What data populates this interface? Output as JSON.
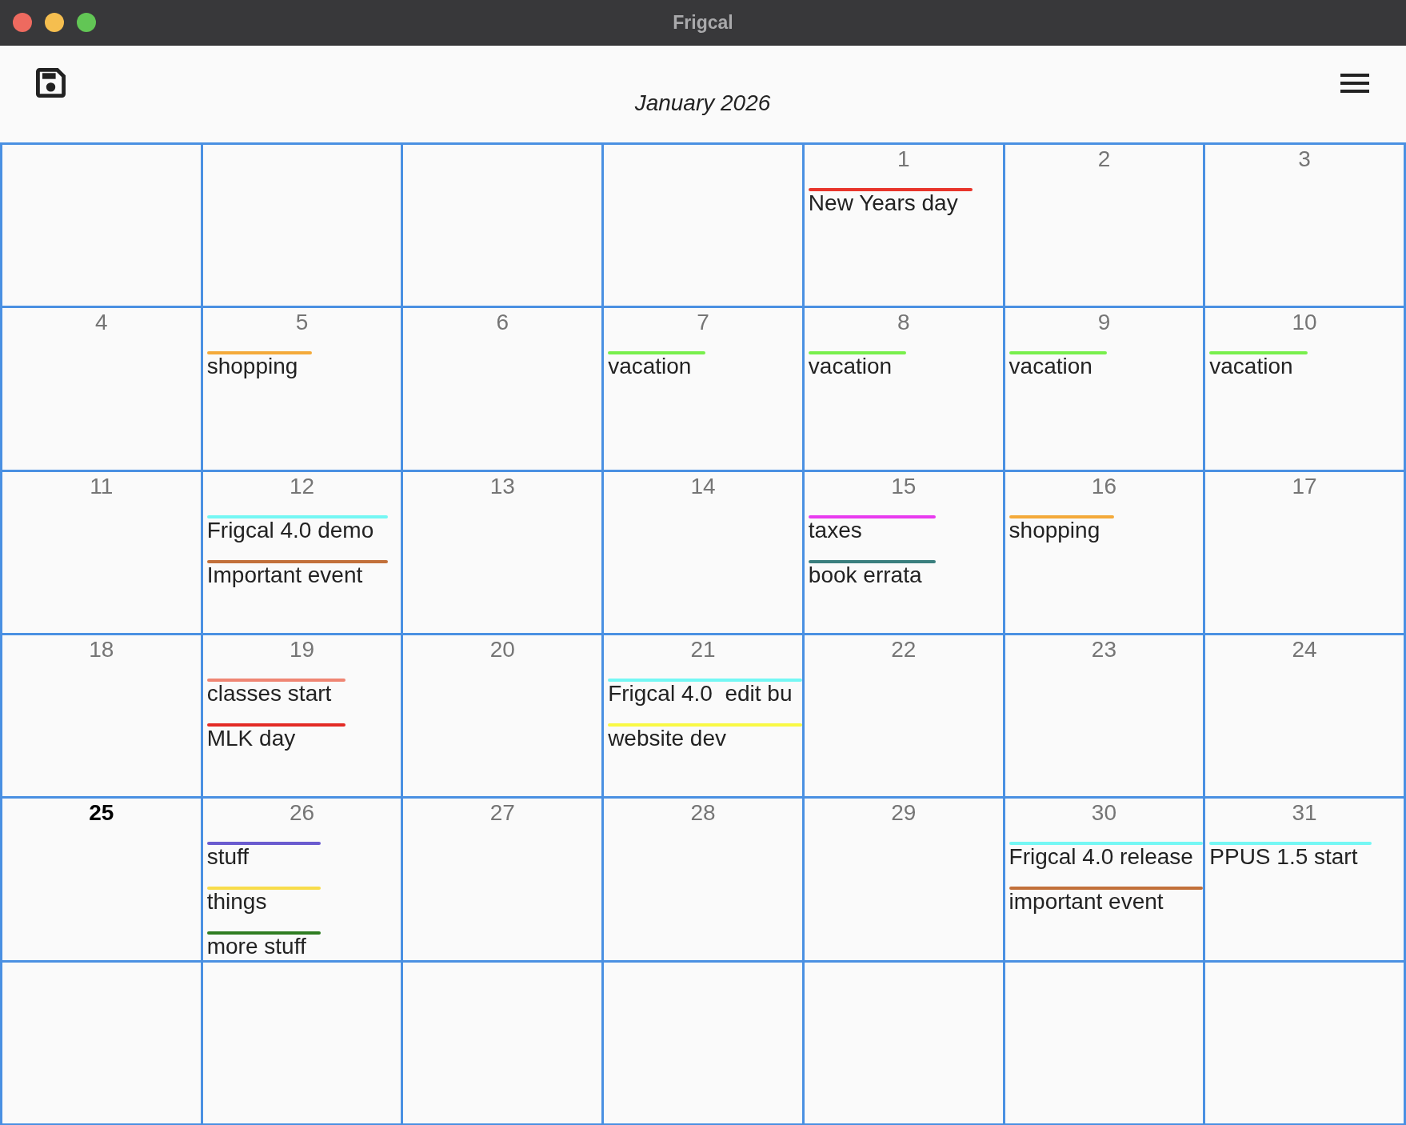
{
  "window": {
    "title": "Frigcal"
  },
  "toolbar": {
    "month_title": "January 2026"
  },
  "calendar": {
    "weeks": [
      {
        "days": [
          {
            "kind": "blank"
          },
          {
            "kind": "blank"
          },
          {
            "kind": "blank"
          },
          {
            "kind": "blank"
          },
          {
            "kind": "day",
            "date": "1",
            "today": false,
            "events": [
              {
                "title": "New Years day",
                "color": "#e8352b"
              }
            ]
          },
          {
            "kind": "day",
            "date": "2",
            "today": false
          },
          {
            "kind": "day",
            "date": "3",
            "today": false
          }
        ]
      },
      {
        "days": [
          {
            "kind": "day",
            "date": "4",
            "today": false
          },
          {
            "kind": "day",
            "date": "5",
            "today": false,
            "events": [
              {
                "title": "shopping",
                "color": "#f4aa3a"
              }
            ]
          },
          {
            "kind": "day",
            "date": "6",
            "today": false
          },
          {
            "kind": "day",
            "date": "7",
            "today": false,
            "events": [
              {
                "title": "vacation",
                "color": "#78ef4c"
              }
            ]
          },
          {
            "kind": "day",
            "date": "8",
            "today": false,
            "events": [
              {
                "title": "vacation",
                "color": "#78ef4c"
              }
            ]
          },
          {
            "kind": "day",
            "date": "9",
            "today": false,
            "events": [
              {
                "title": "vacation",
                "color": "#78ef4c"
              }
            ]
          },
          {
            "kind": "day",
            "date": "10",
            "today": false,
            "events": [
              {
                "title": "vacation",
                "color": "#78ef4c"
              }
            ]
          }
        ]
      },
      {
        "days": [
          {
            "kind": "day",
            "date": "11",
            "today": false
          },
          {
            "kind": "day",
            "date": "12",
            "today": false,
            "events": [
              {
                "title": "Frigcal 4.0 demo",
                "color": "#74f7f4"
              },
              {
                "title": "Important event",
                "color": "#c2703a"
              }
            ]
          },
          {
            "kind": "day",
            "date": "13",
            "today": false
          },
          {
            "kind": "day",
            "date": "14",
            "today": false
          },
          {
            "kind": "day",
            "date": "15",
            "today": false,
            "events": [
              {
                "title": "taxes",
                "color": "#e83bef"
              },
              {
                "title": "book errata",
                "color": "#3a7f7e"
              }
            ]
          },
          {
            "kind": "day",
            "date": "16",
            "today": false,
            "events": [
              {
                "title": "shopping",
                "color": "#f4aa3a"
              }
            ]
          },
          {
            "kind": "day",
            "date": "17",
            "today": false
          }
        ]
      },
      {
        "days": [
          {
            "kind": "day",
            "date": "18",
            "today": false
          },
          {
            "kind": "day",
            "date": "19",
            "today": false,
            "events": [
              {
                "title": "classes start",
                "color": "#ef8573"
              },
              {
                "title": "MLK day",
                "color": "#e32b25"
              }
            ]
          },
          {
            "kind": "day",
            "date": "20",
            "today": false
          },
          {
            "kind": "day",
            "date": "21",
            "today": false,
            "events": [
              {
                "title": "Frigcal 4.0  edit bu",
                "color": "#74f7f4"
              },
              {
                "title": "website dev",
                "color": "#f9f944"
              }
            ]
          },
          {
            "kind": "day",
            "date": "22",
            "today": false
          },
          {
            "kind": "day",
            "date": "23",
            "today": false
          },
          {
            "kind": "day",
            "date": "24",
            "today": false
          }
        ]
      },
      {
        "days": [
          {
            "kind": "day",
            "date": "25",
            "today": true
          },
          {
            "kind": "day",
            "date": "26",
            "today": false,
            "events": [
              {
                "title": "stuff",
                "color": "#6a5bcf"
              },
              {
                "title": "things",
                "color": "#f8dc4a"
              },
              {
                "title": "more stuff",
                "color": "#2f7d22"
              }
            ]
          },
          {
            "kind": "day",
            "date": "27",
            "today": false
          },
          {
            "kind": "day",
            "date": "28",
            "today": false
          },
          {
            "kind": "day",
            "date": "29",
            "today": false
          },
          {
            "kind": "day",
            "date": "30",
            "today": false,
            "events": [
              {
                "title": "Frigcal 4.0 release",
                "color": "#74f7f4"
              },
              {
                "title": "important event",
                "color": "#c2703a"
              }
            ]
          },
          {
            "kind": "day",
            "date": "31",
            "today": false,
            "events": [
              {
                "title": "PPUS 1.5 start",
                "color": "#74f7f4"
              }
            ]
          }
        ]
      },
      {
        "days": [
          {
            "kind": "blank"
          },
          {
            "kind": "blank"
          },
          {
            "kind": "blank"
          },
          {
            "kind": "blank"
          },
          {
            "kind": "blank"
          },
          {
            "kind": "blank"
          },
          {
            "kind": "blank"
          }
        ]
      }
    ]
  }
}
